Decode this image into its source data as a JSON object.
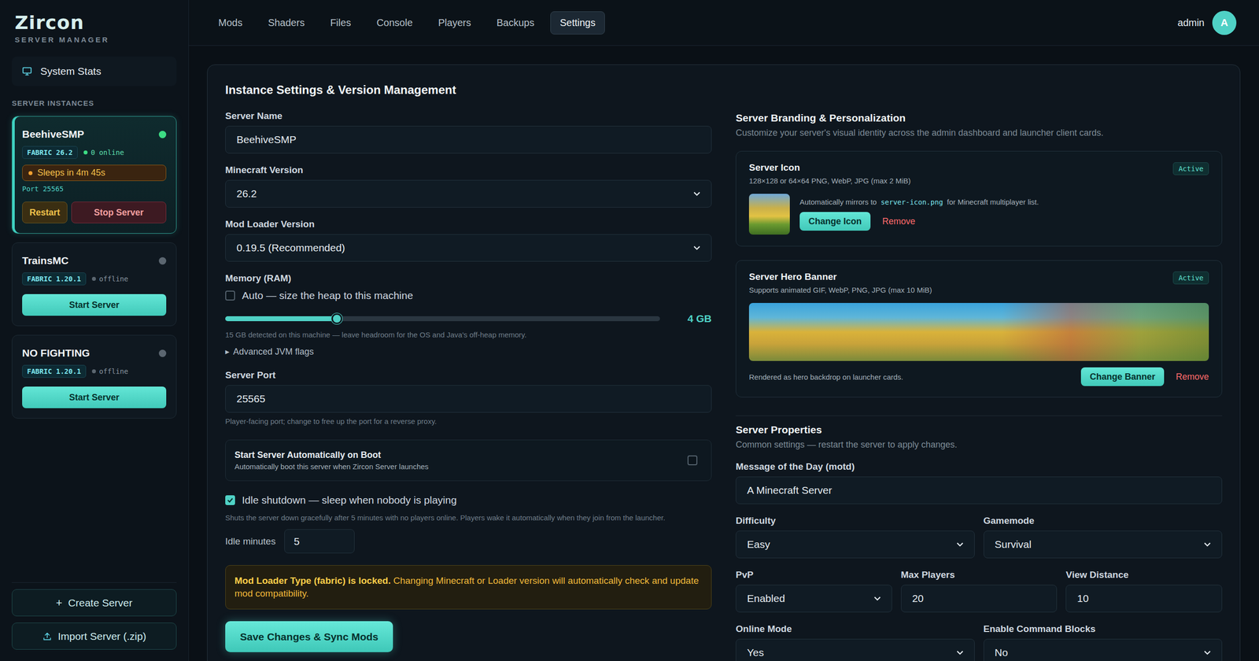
{
  "brand": {
    "name": "Zircon",
    "subtitle": "SERVER MANAGER"
  },
  "sidebar": {
    "system_stats": "System Stats",
    "section_label": "SERVER INSTANCES",
    "instances": [
      {
        "name": "BeehiveSMP",
        "loader": "FABRIC 26.2",
        "status": "0 online",
        "online": true,
        "color": "#3ddc84",
        "selected": true,
        "sleep": "Sleeps in 4m 45s",
        "port": "Port 25565",
        "buttons": [
          {
            "label": "Restart",
            "kind": "restart"
          },
          {
            "label": "Stop Server",
            "kind": "stop"
          }
        ]
      },
      {
        "name": "TrainsMC",
        "loader": "FABRIC 1.20.1",
        "status": "offline",
        "online": false,
        "color": "#5b6670",
        "selected": false,
        "buttons": [
          {
            "label": "Start Server",
            "kind": "start"
          }
        ]
      },
      {
        "name": "NO FIGHTING",
        "loader": "FABRIC 1.20.1",
        "status": "offline",
        "online": false,
        "color": "#5b6670",
        "selected": false,
        "buttons": [
          {
            "label": "Start Server",
            "kind": "start"
          }
        ]
      }
    ],
    "create": {
      "icon": "+",
      "label": "Create Server"
    },
    "import": {
      "label": "Import Server (.zip)"
    }
  },
  "nav": {
    "tabs": [
      {
        "label": "Mods",
        "selected": false
      },
      {
        "label": "Shaders",
        "selected": false
      },
      {
        "label": "Files",
        "selected": false
      },
      {
        "label": "Console",
        "selected": false
      },
      {
        "label": "Players",
        "selected": false
      },
      {
        "label": "Backups",
        "selected": false
      },
      {
        "label": "Settings",
        "selected": true
      }
    ],
    "user": {
      "name": "admin",
      "avatar": "A"
    }
  },
  "panel": {
    "title": "Instance Settings & Version Management",
    "settings": {
      "server_name": {
        "label": "Server Name",
        "value": "BeehiveSMP"
      },
      "minecraft_version": {
        "label": "Minecraft Version",
        "value": "26.2"
      },
      "loader_version": {
        "label": "Mod Loader Version",
        "value": "0.19.5 (Recommended)"
      },
      "memory": {
        "label": "Memory (RAM)",
        "auto": {
          "label": "Auto — size the heap to this machine",
          "checked": false
        },
        "level": 0.257,
        "reading": "4 GB",
        "hint": "15 GB detected on this machine — leave headroom for the OS and Java's off-heap memory.",
        "advanced": {
          "icon": "▶",
          "label": "Advanced JVM flags",
          "expanded": false
        }
      },
      "port": {
        "label": "Server Port",
        "value": "25565",
        "hint": "Player-facing port; change to free up the port for a reverse proxy."
      },
      "autostart": {
        "title": "Start Server Automatically on Boot",
        "description": "Automatically boot this server when Zircon Server launches",
        "checked": false
      },
      "idle": {
        "label": "Idle shutdown — sleep when nobody is playing",
        "checked": true,
        "hint": "Shuts the server down gracefully after 5 minutes with no players online. Players wake it automatically when they join from the launcher.",
        "minutes_label": "Idle minutes",
        "minutes": "5"
      },
      "warning": {
        "bold": "Mod Loader Type (fabric) is locked.",
        "text": "Changing Minecraft or Loader version will automatically check and update mod compatibility."
      },
      "save": "Save Changes & Sync Mods"
    },
    "branding": {
      "title": "Server Branding & Personalization",
      "subtitle": "Customize your server's visual identity across the admin dashboard and launcher client cards.",
      "icon_card": {
        "title": "Server Icon",
        "hint": "128×128 or 64×64 PNG, WebP, JPG (max 2 MiB)",
        "badge": "Active",
        "mirror_before": "Automatically mirrors to",
        "mirror_file": "server-icon.png",
        "mirror_after": "for Minecraft multiplayer list.",
        "change": "Change Icon",
        "remove": "Remove"
      },
      "banner_card": {
        "title": "Server Hero Banner",
        "hint": "Supports animated GIF, WebP, PNG, JPG (max 10 MiB)",
        "badge": "Active",
        "caption": "Rendered as hero backdrop on launcher cards.",
        "change": "Change Banner",
        "remove": "Remove"
      }
    },
    "properties": {
      "title": "Server Properties",
      "subtitle": "Common settings — restart the server to apply changes.",
      "rows": [
        [
          {
            "label": "Message of the Day (motd)",
            "value": "A Minecraft Server",
            "kind": "input"
          }
        ],
        [
          {
            "label": "Difficulty",
            "value": "Easy",
            "kind": "select"
          },
          {
            "label": "Gamemode",
            "value": "Survival",
            "kind": "select"
          }
        ],
        [
          {
            "label": "PvP",
            "value": "Enabled",
            "kind": "select"
          },
          {
            "label": "Max Players",
            "value": "20",
            "kind": "input"
          },
          {
            "label": "View Distance",
            "value": "10",
            "kind": "input"
          }
        ],
        [
          {
            "label": "Online Mode",
            "value": "Yes",
            "kind": "select"
          },
          {
            "label": "Enable Command Blocks",
            "value": "No",
            "kind": "select"
          }
        ]
      ]
    }
  }
}
